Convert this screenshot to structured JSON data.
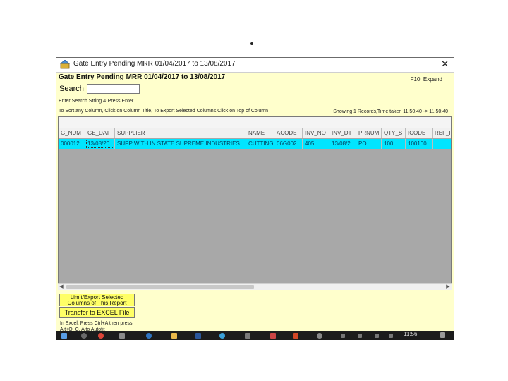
{
  "window": {
    "title": "Gate Entry Pending MRR 01/04/2017 to 13/08/2017",
    "close_glyph": "✕"
  },
  "header": {
    "title": "Gate Entry Pending MRR 01/04/2017 to 13/08/2017",
    "f10": "F10: Expand"
  },
  "search": {
    "label": "Search",
    "value": "",
    "placeholder": ""
  },
  "hint": "Enter Search String & Press Enter",
  "sort_info": "To Sort any Column, Click on Column Title, To Export Selected Columns,Click on Top of Column",
  "showing": "Showing 1 Records,Time taken 11:50:40 -> 11:50:40",
  "table": {
    "columns": [
      "G_NUM",
      "GE_DAT",
      "SUPPLIER",
      "NAME",
      "ACODE",
      "INV_NO",
      "INV_DT",
      "PRNUM",
      "QTY_S",
      "ICODE",
      "REF_RT"
    ],
    "rows": [
      [
        "000012",
        "13/08/20",
        "SUPP WITH IN STATE SUPREME INDUSTRIES",
        "CUTTING",
        "06G002",
        "405",
        "13/08/2",
        "PO",
        "100",
        "100100",
        ""
      ]
    ]
  },
  "buttons": {
    "export_label": "Limit/Export Selected Columns of This Report",
    "excel_label": "Transfer to EXCEL File"
  },
  "excel_note": "In Excel, Press Ctrl+A then press Alt+O, C, A to Autofit",
  "taskbar": {
    "time": "11:56"
  },
  "colors": {
    "window_bg": "#ffffcc",
    "selected_row": "#00e5ff",
    "grid_bg": "#a8a8a8",
    "button_bg": "#ffff66",
    "taskbar_bg": "#1c1c1c"
  }
}
